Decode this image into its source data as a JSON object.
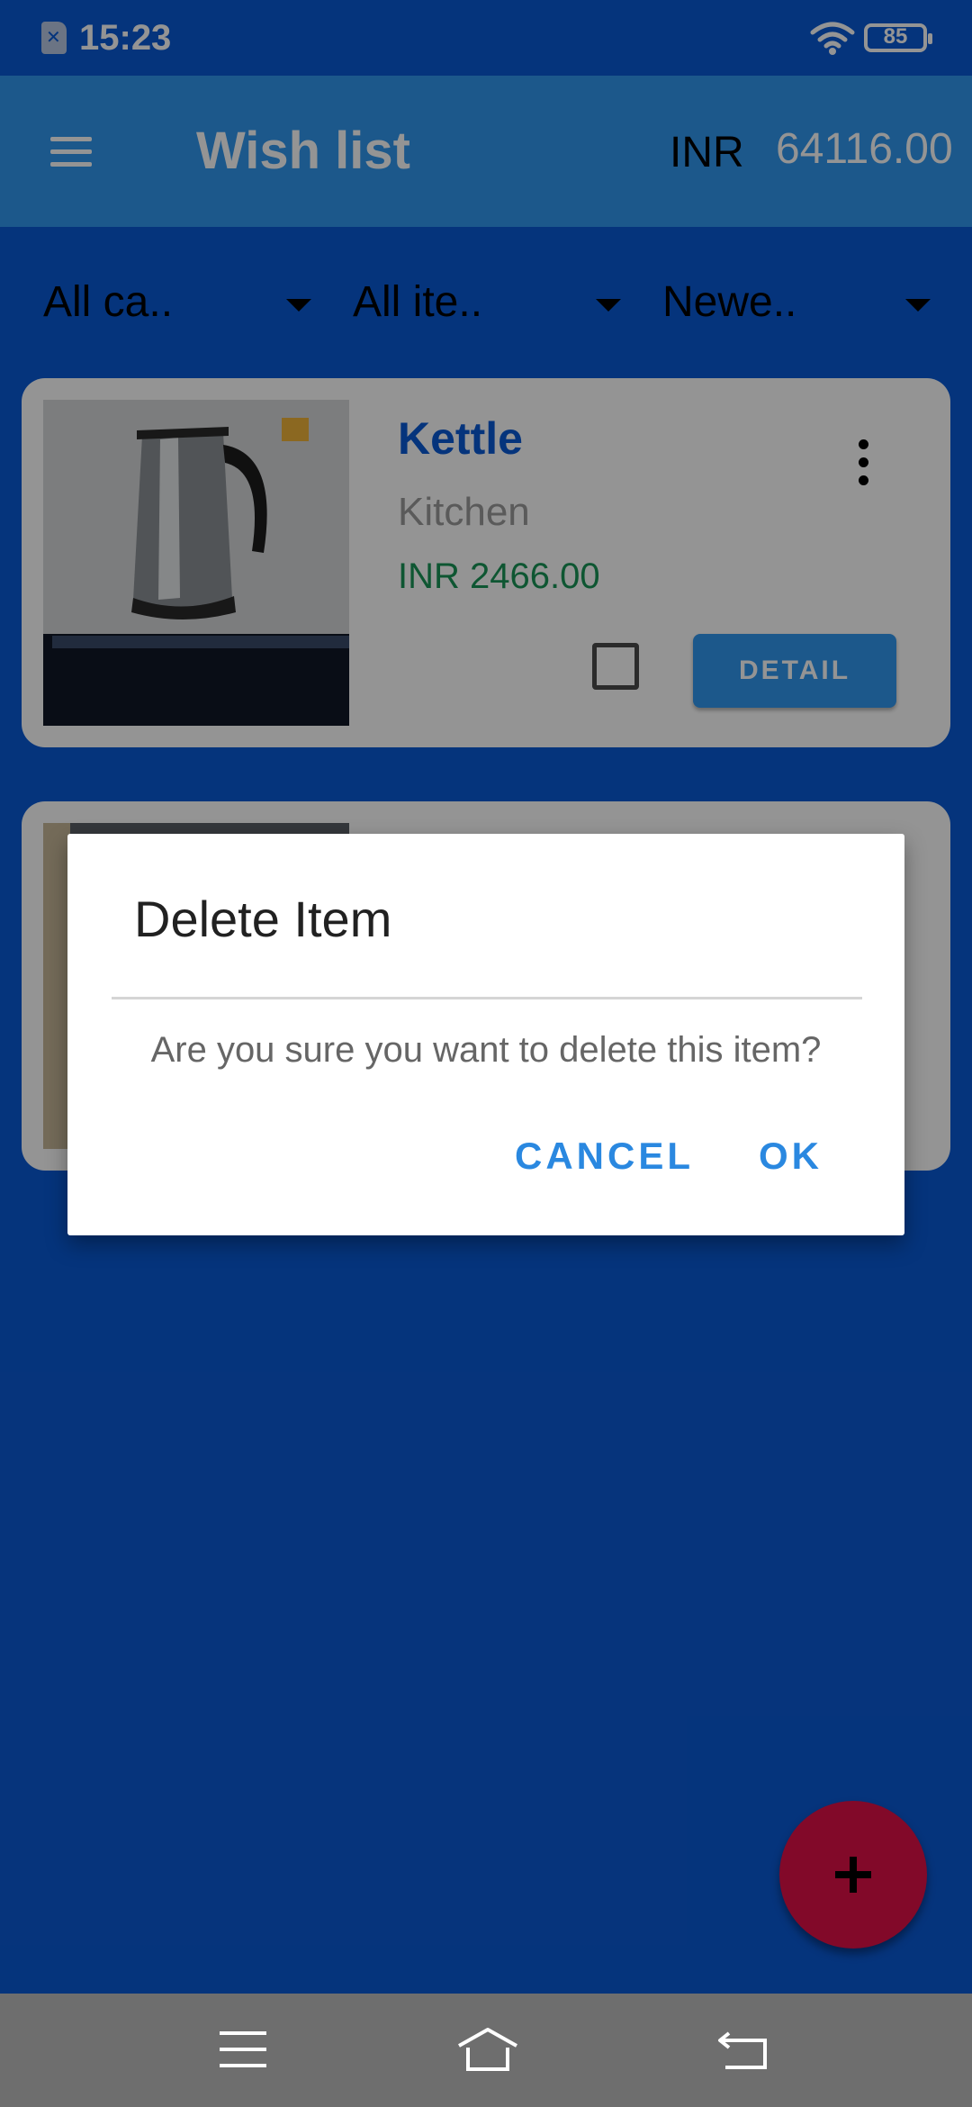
{
  "status_bar": {
    "time": "15:23",
    "battery": "85",
    "icons": [
      "sim-icon",
      "wifi-icon",
      "battery-icon"
    ]
  },
  "app_bar": {
    "title": "Wish list",
    "currency": "INR",
    "total": "64116.00",
    "menu_icon": "menu-icon"
  },
  "filters": [
    {
      "label": "All ca.."
    },
    {
      "label": "All ite.."
    },
    {
      "label": "Newe.."
    }
  ],
  "items": [
    {
      "name": "Kettle",
      "category": "Kitchen",
      "price": "INR 2466.00",
      "detail_label": "DETAIL",
      "checked": false
    }
  ],
  "dialog": {
    "title": "Delete Item",
    "message": "Are you sure you want to delete this item?",
    "cancel_label": "CANCEL",
    "ok_label": "OK"
  },
  "fab": {
    "icon": "plus-icon"
  },
  "nav_bar": {
    "icons": [
      "nav-menu-icon",
      "nav-home-icon",
      "nav-back-icon"
    ]
  },
  "colors": {
    "primary": "#0a5ad6",
    "app_bar": "#3198f0",
    "price": "#199456",
    "fab": "#e01048",
    "dialog_button": "#2a88e0"
  }
}
